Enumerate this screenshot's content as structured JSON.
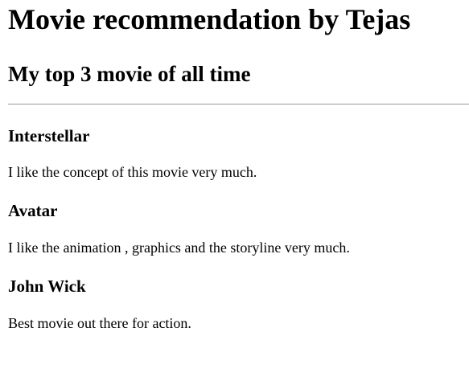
{
  "page": {
    "title": "Movie recommendation by Tejas",
    "subtitle": "My top 3 movie of all time"
  },
  "movies": [
    {
      "name": "Interstellar",
      "description": "I like the concept of this movie very much."
    },
    {
      "name": "Avatar",
      "description": "I like the animation , graphics and the storyline very much."
    },
    {
      "name": "John Wick",
      "description": "Best movie out there for action."
    }
  ],
  "colors": {
    "background": "#ffffff",
    "text": "#000000",
    "divider": "#999999"
  }
}
